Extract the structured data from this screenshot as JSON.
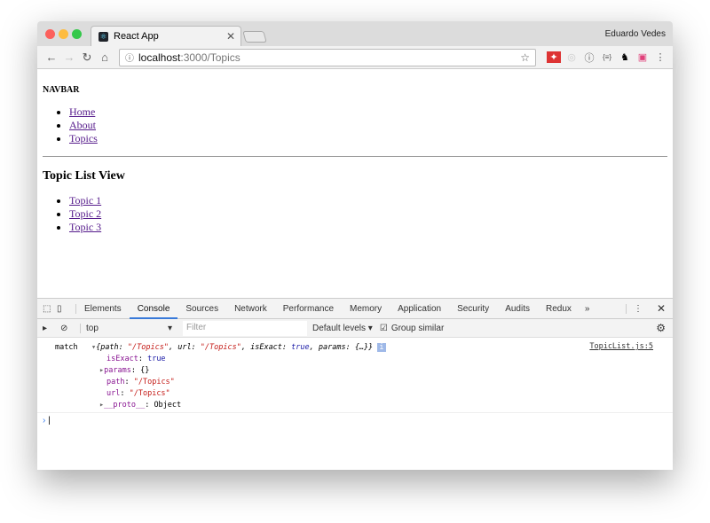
{
  "browser": {
    "tab_title": "React App",
    "user": "Eduardo Vedes",
    "url_host": "localhost",
    "url_path": ":3000/Topics"
  },
  "page": {
    "navbar": "NAVBAR",
    "nav_links": [
      "Home",
      "About",
      "Topics"
    ],
    "heading": "Topic List View",
    "topics": [
      "Topic 1",
      "Topic 2",
      "Topic 3"
    ]
  },
  "devtools": {
    "tabs": [
      "Elements",
      "Console",
      "Sources",
      "Network",
      "Performance",
      "Memory",
      "Application",
      "Security",
      "Audits",
      "Redux"
    ],
    "active_tab": "Console",
    "context": "top",
    "filter_placeholder": "Filter",
    "levels": "Default levels",
    "group_similar": "Group similar",
    "group_similar_checked": true
  },
  "console": {
    "label": "match",
    "summary_pre": "{path: ",
    "path_val": "\"/Topics\"",
    "summary_mid": ", url: ",
    "url_val": "\"/Topics\"",
    "summary_mid2": ", isExact: ",
    "exact_val": "true",
    "summary_post": ", params: {…}}",
    "source": "TopicList.js:5",
    "props": [
      {
        "key": "isExact",
        "val": "true"
      },
      {
        "key": "params",
        "val": "{}"
      },
      {
        "key": "path",
        "val": "\"/Topics\""
      },
      {
        "key": "url",
        "val": "\"/Topics\""
      },
      {
        "key": "__proto__",
        "val": "Object"
      }
    ]
  }
}
